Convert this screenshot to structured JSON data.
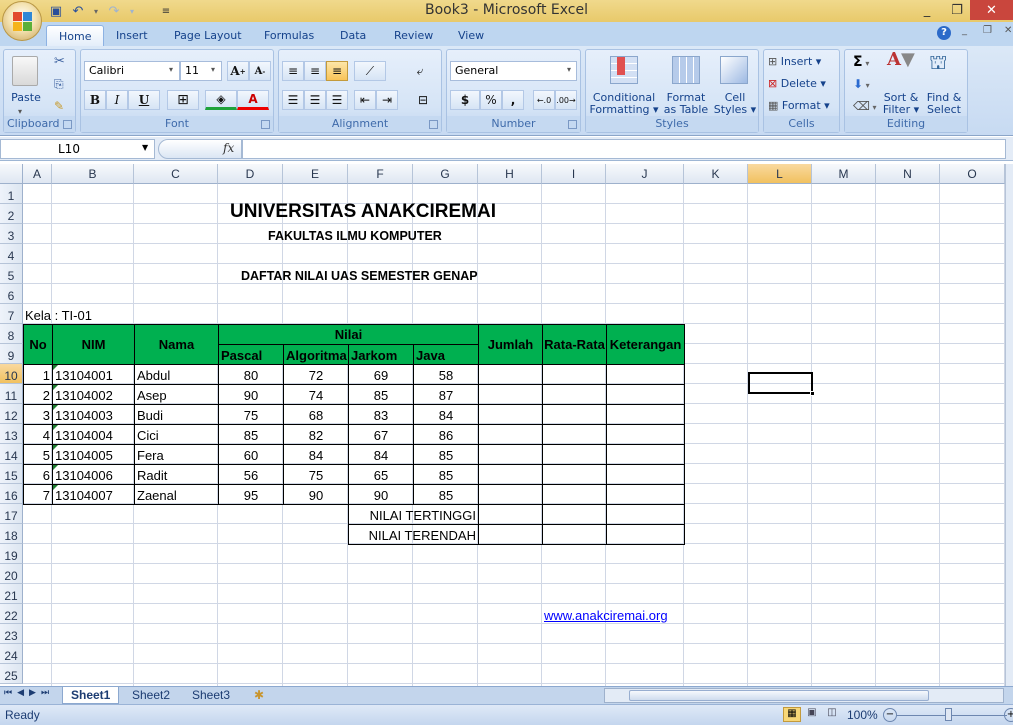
{
  "window": {
    "title": "Book3 - Microsoft Excel"
  },
  "qat": {
    "icons": [
      "save-icon",
      "undo-icon",
      "redo-icon",
      "customize-icon"
    ]
  },
  "tabs": [
    {
      "label": "Home",
      "active": true
    },
    {
      "label": "Insert"
    },
    {
      "label": "Page Layout"
    },
    {
      "label": "Formulas"
    },
    {
      "label": "Data"
    },
    {
      "label": "Review"
    },
    {
      "label": "View"
    }
  ],
  "ribbon": {
    "clipboard": {
      "label": "Clipboard",
      "paste": "Paste"
    },
    "font": {
      "label": "Font",
      "name": "Calibri",
      "size": "11",
      "bold": "B",
      "italic": "I",
      "underline": "U"
    },
    "alignment": {
      "label": "Alignment"
    },
    "number": {
      "label": "Number",
      "format": "General",
      "currency": "$",
      "percent": "%",
      "comma": ","
    },
    "styles": {
      "label": "Styles",
      "conditional": [
        "Conditional",
        "Formatting ▾"
      ],
      "format_table": [
        "Format",
        "as Table ▾"
      ],
      "cell_styles": [
        "Cell",
        "Styles ▾"
      ]
    },
    "cells": {
      "label": "Cells",
      "insert": "Insert ▾",
      "delete": "Delete ▾",
      "format": "Format ▾"
    },
    "editing": {
      "label": "Editing",
      "sort": [
        "Sort &",
        "Filter ▾"
      ],
      "find": [
        "Find &",
        "Select ▾"
      ]
    }
  },
  "formula_bar": {
    "name_box": "L10",
    "fx": "fx",
    "value": ""
  },
  "columns": [
    "A",
    "B",
    "C",
    "D",
    "E",
    "F",
    "G",
    "H",
    "I",
    "J",
    "K",
    "L",
    "M",
    "N",
    "O"
  ],
  "selected_column": "L",
  "selected_row": 10,
  "rows": [
    1,
    2,
    3,
    4,
    5,
    6,
    7,
    8,
    9,
    10,
    11,
    12,
    13,
    14,
    15,
    16,
    17,
    18,
    19,
    20,
    21,
    22,
    23,
    24,
    25
  ],
  "sheet": {
    "title": "UNIVERSITAS ANAKCIREMAI",
    "faculty": "FAKULTAS ILMU KOMPUTER",
    "subtitle": "DAFTAR NILAI UAS SEMESTER GENAP",
    "kelas": "Kela : TI-01",
    "headers": {
      "no": "No",
      "nim": "NIM",
      "nama": "Nama",
      "nilai": "Nilai",
      "pascal": "Pascal",
      "algoritma": "Algoritma",
      "jarkom": "Jarkom",
      "java": "Java",
      "jumlah": "Jumlah",
      "rata": "Rata-Rata",
      "keterangan": "Keterangan"
    },
    "students": [
      {
        "no": "1",
        "nim": "13104001",
        "nama": "Abdul",
        "pascal": "80",
        "algoritma": "72",
        "jarkom": "69",
        "java": "58"
      },
      {
        "no": "2",
        "nim": "13104002",
        "nama": "Asep",
        "pascal": "90",
        "algoritma": "74",
        "jarkom": "85",
        "java": "87"
      },
      {
        "no": "3",
        "nim": "13104003",
        "nama": "Budi",
        "pascal": "75",
        "algoritma": "68",
        "jarkom": "83",
        "java": "84"
      },
      {
        "no": "4",
        "nim": "13104004",
        "nama": "Cici",
        "pascal": "85",
        "algoritma": "82",
        "jarkom": "67",
        "java": "86"
      },
      {
        "no": "5",
        "nim": "13104005",
        "nama": "Fera",
        "pascal": "60",
        "algoritma": "84",
        "jarkom": "84",
        "java": "85"
      },
      {
        "no": "6",
        "nim": "13104006",
        "nama": "Radit",
        "pascal": "56",
        "algoritma": "75",
        "jarkom": "65",
        "java": "85"
      },
      {
        "no": "7",
        "nim": "13104007",
        "nama": "Zaenal",
        "pascal": "95",
        "algoritma": "90",
        "jarkom": "90",
        "java": "85"
      }
    ],
    "max_label": "NILAI TERTINGGI",
    "min_label": "NILAI TERENDAH",
    "link": "www.anakciremai.org"
  },
  "sheet_tabs": [
    "Sheet1",
    "Sheet2",
    "Sheet3"
  ],
  "active_sheet": "Sheet1",
  "status": {
    "text": "Ready",
    "zoom": "100%"
  },
  "colors": {
    "header_green": "#00b050",
    "link": "#0000ff"
  }
}
